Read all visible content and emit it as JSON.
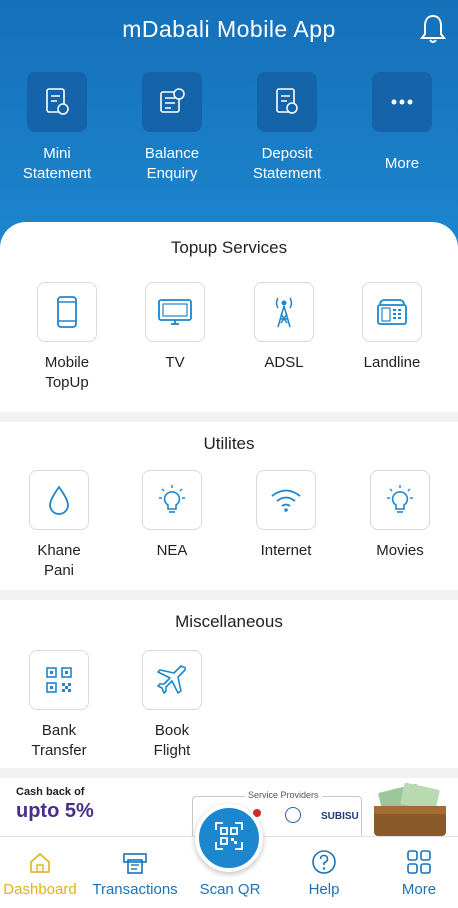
{
  "app": {
    "title": "mDabali Mobile App"
  },
  "colors": {
    "header": "#1c86cf",
    "tile": "#1563a8",
    "icon": "#1c86cf",
    "active_nav": "#e0b21f",
    "promo": "#4a2d8a"
  },
  "quick_actions": [
    {
      "label_line1": "Mini",
      "label_line2": "Statement",
      "icon": "statement-icon"
    },
    {
      "label_line1": "Balance",
      "label_line2": "Enquiry",
      "icon": "balance-icon"
    },
    {
      "label_line1": "Deposit",
      "label_line2": "Statement",
      "icon": "deposit-icon"
    },
    {
      "label_line1": "More",
      "label_line2": "",
      "icon": "more-dots-icon"
    }
  ],
  "topup": {
    "title": "Topup Services",
    "items": [
      {
        "label_line1": "Mobile",
        "label_line2": "TopUp",
        "icon": "mobile-icon"
      },
      {
        "label_line1": "TV",
        "label_line2": "",
        "icon": "tv-icon"
      },
      {
        "label_line1": "ADSL",
        "label_line2": "",
        "icon": "antenna-icon"
      },
      {
        "label_line1": "Landline",
        "label_line2": "",
        "icon": "phone-icon"
      }
    ]
  },
  "utilities": {
    "title": "Utilites",
    "items": [
      {
        "label_line1": "Khane",
        "label_line2": "Pani",
        "icon": "water-drop-icon"
      },
      {
        "label_line1": "NEA",
        "label_line2": "",
        "icon": "bulb-icon"
      },
      {
        "label_line1": "Internet",
        "label_line2": "",
        "icon": "wifi-icon"
      },
      {
        "label_line1": "Movies",
        "label_line2": "",
        "icon": "bulb-icon"
      }
    ]
  },
  "misc": {
    "title": "Miscellaneous",
    "items": [
      {
        "label_line1": "Bank",
        "label_line2": "Transfer",
        "icon": "qr-icon"
      },
      {
        "label_line1": "Book",
        "label_line2": "Flight",
        "icon": "plane-icon"
      }
    ]
  },
  "banner": {
    "cashback_small": "Cash back of",
    "cashback_big": "upto 5%",
    "service_providers": "Service Providers",
    "provider_logo": "SUBISU"
  },
  "nav": {
    "items": [
      {
        "label": "Dashboard",
        "icon": "home-icon"
      },
      {
        "label": "Transactions",
        "icon": "receipt-icon"
      },
      {
        "label": "Scan QR",
        "icon": "qr-scan-icon"
      },
      {
        "label": "Help",
        "icon": "help-icon"
      },
      {
        "label": "More",
        "icon": "grid-icon"
      }
    ]
  }
}
